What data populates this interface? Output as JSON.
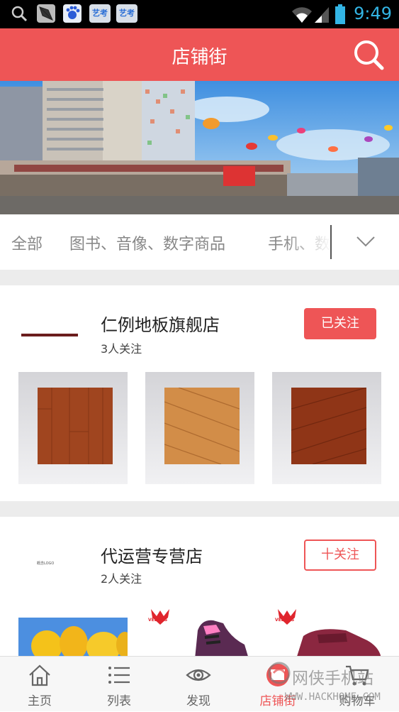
{
  "status_bar": {
    "time": "9:49",
    "notification_icons": [
      "search-icon",
      "kite-app-icon",
      "baidu-icon",
      "yikao-app-icon",
      "yikao-app-icon"
    ],
    "badge_label": "艺考"
  },
  "header": {
    "title": "店铺街"
  },
  "banner": {
    "image": "shopping-mall-building-with-kites"
  },
  "categories": {
    "items": [
      "全部",
      "图书、音像、数字商品",
      "手机、数"
    ]
  },
  "shops": [
    {
      "name": "仁例地板旗舰店",
      "followers": "3人关注",
      "follow_label": "已关注",
      "followed": true,
      "products": [
        "wood-flooring-1",
        "wood-flooring-2",
        "wood-flooring-3"
      ]
    },
    {
      "name": "代运营专营店",
      "followers": "2人关注",
      "follow_label": "十关注",
      "followed": false,
      "logo_text": "概念LOGO",
      "products": [
        "yellow-tulips",
        "kids-shoe-veemes",
        "kids-shoe-veemes-red"
      ]
    }
  ],
  "brand_badge": "VEEMES",
  "tab_bar": {
    "tabs": [
      {
        "label": "主页",
        "icon": "home-icon"
      },
      {
        "label": "列表",
        "icon": "list-icon"
      },
      {
        "label": "发现",
        "icon": "eye-icon"
      },
      {
        "label": "店铺街",
        "icon": "store-icon",
        "active": true
      },
      {
        "label": "购物车",
        "icon": "cart-icon"
      }
    ]
  },
  "watermark": {
    "text": "网侠手机站",
    "url": "WWW.HACKHOME.COM"
  },
  "colors": {
    "accent": "#ee5556",
    "status_time": "#33b5e5"
  }
}
